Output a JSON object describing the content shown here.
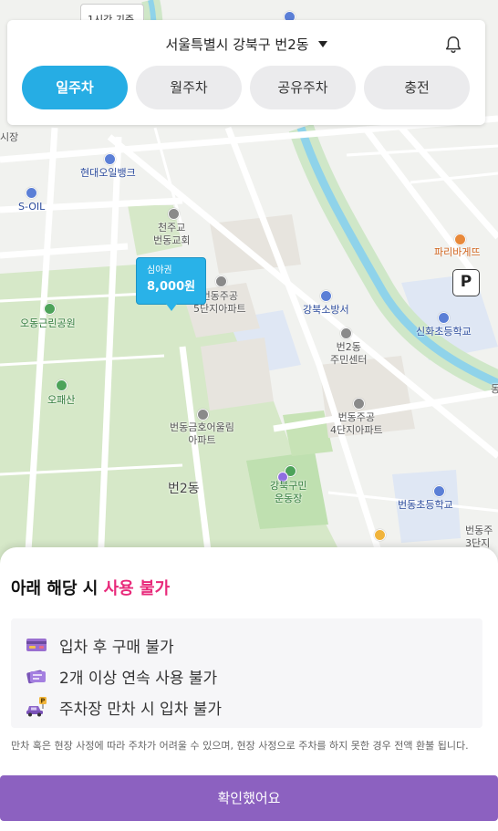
{
  "map": {
    "time_chip": "1시간 기준",
    "labels": {
      "market": "시장",
      "hyundai_oilbank": "현대오일뱅크",
      "s_oil": "S-OIL",
      "church": "천주교\n번동교회",
      "apt5": "번동주공\n5단지아파트",
      "fire_station": "강북소방서",
      "paris_baguette": "파리바게뜨",
      "sinhwa_school": "신화초등학교",
      "community_center": "번2동\n주민센터",
      "apt4": "번동주공\n4단지아파트",
      "park": "오동근린공원",
      "mountain": "오패산",
      "olympic_apt": "번동금호어울림\n아파트",
      "district": "번2동",
      "stadium": "강북구민\n운동장",
      "beondong_school": "번동초등학교",
      "apt3": "번동주\n3단지",
      "right_edge": "동"
    },
    "price_marker": {
      "label": "심야권",
      "price": "8,000원"
    },
    "parking_pin": "P"
  },
  "header": {
    "location": "서울특별시 강북구 번2동",
    "bell_icon": "bell-icon",
    "tabs": [
      {
        "label": "일주차",
        "active": true
      },
      {
        "label": "월주차",
        "active": false
      },
      {
        "label": "공유주차",
        "active": false
      },
      {
        "label": "충전",
        "active": false
      }
    ]
  },
  "sheet": {
    "title_prefix": "아래 해당 시",
    "title_warning": "사용 불가",
    "rules": [
      {
        "icon": "credit-card-icon",
        "text": "입차 후 구매 불가"
      },
      {
        "icon": "tickets-icon",
        "text": "2개 이상 연속 사용 불가"
      },
      {
        "icon": "car-parking-icon",
        "text": "주차장 만차 시 입차 불가"
      }
    ],
    "notice": "만차 혹은 현장 사정에 따라 주차가 어려울 수 있으며, 현장 사정으로 주차를 하지 못한 경우 전액 환불 됩니다.",
    "confirm_label": "확인했어요"
  },
  "colors": {
    "accent": "#26ade4",
    "warning": "#e8297a",
    "confirm": "#8c61c0"
  }
}
